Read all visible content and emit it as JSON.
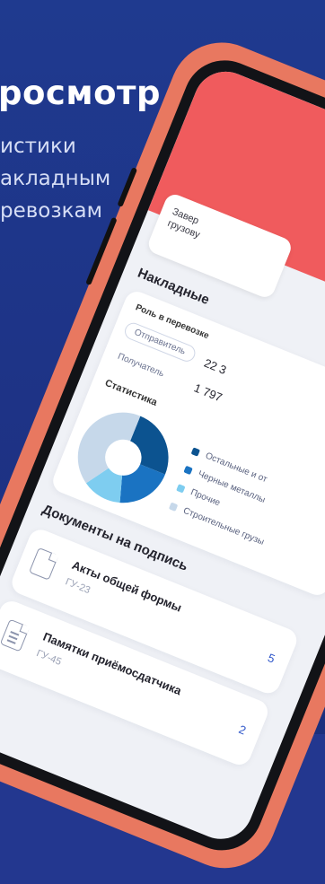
{
  "promo": {
    "headline": "росмотр",
    "line1": "истики",
    "line2": "акладным",
    "line3": "ревозкам"
  },
  "app": {
    "hero_card_text_1": "Завер",
    "hero_card_text_2": "грузову",
    "invoices_title": "Накладные",
    "role_label": "Роль в перевозке",
    "sender_label": "Отправитель",
    "sender_value": "22 3",
    "receiver_label": "Получатель",
    "receiver_value": "1 797",
    "stats_title": "Статистика",
    "legend": [
      {
        "label": "Остальные и от",
        "color": "#0c5390"
      },
      {
        "label": "Черные металлы",
        "color": "#1a73c2"
      },
      {
        "label": "Прочие",
        "color": "#7ecdf0"
      },
      {
        "label": "Строительные грузы",
        "color": "#c6d8ea"
      }
    ],
    "docs_title": "Документы на подпись",
    "docs": [
      {
        "title": "Акты общей формы",
        "code": "ГУ-23",
        "count": "5"
      },
      {
        "title": "Памятки приёмосдатчика",
        "code": "ГУ-45",
        "count": "2"
      }
    ]
  }
}
